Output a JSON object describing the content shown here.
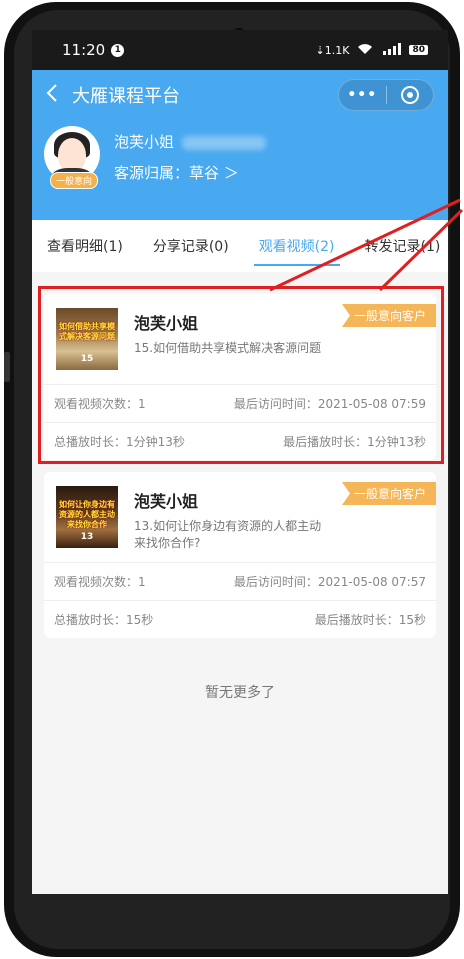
{
  "status_bar": {
    "time": "11:20",
    "notif_badge": "1",
    "network": "1.1K",
    "battery": "80"
  },
  "nav": {
    "back_icon": "chevron-left-icon",
    "title": "大雁课程平台",
    "more": "•••"
  },
  "user": {
    "name": "泡芙小姐",
    "source": "客源归属：草谷 ＞",
    "badge": "一般意向"
  },
  "tabs": [
    {
      "label": "查看明细(1)"
    },
    {
      "label": "分享记录(0)"
    },
    {
      "label": "观看视频(2)",
      "active": true
    },
    {
      "label": "转发记录(1)"
    }
  ],
  "records": [
    {
      "name": "泡芙小姐",
      "tag": "一般意向客户",
      "video": "15.如何借助共享模式解决客源问题",
      "thumb_text": "如何借助共享模式解决客源问题",
      "thumb_num": "15",
      "view_count": "观看视频次数：1",
      "last_visit": "最后访问时间：2021-05-08 07:59",
      "total_duration": "总播放时长：1分钟13秒",
      "last_duration": "最后播放时长：1分钟13秒"
    },
    {
      "name": "泡芙小姐",
      "tag": "一般意向客户",
      "video": "13.如何让你身边有资源的人都主动来找你合作?",
      "thumb_text": "如何让你身边有资源的人都主动来找你合作",
      "thumb_num": "13",
      "view_count": "观看视频次数：1",
      "last_visit": "最后访问时间：2021-05-08 07:57",
      "total_duration": "总播放时长：15秒",
      "last_duration": "最后播放时长：15秒"
    }
  ],
  "footer": {
    "no_more": "暂无更多了"
  },
  "colors": {
    "header": "#48a8f0",
    "tag": "#f5b65a",
    "annotation": "#e02020"
  }
}
